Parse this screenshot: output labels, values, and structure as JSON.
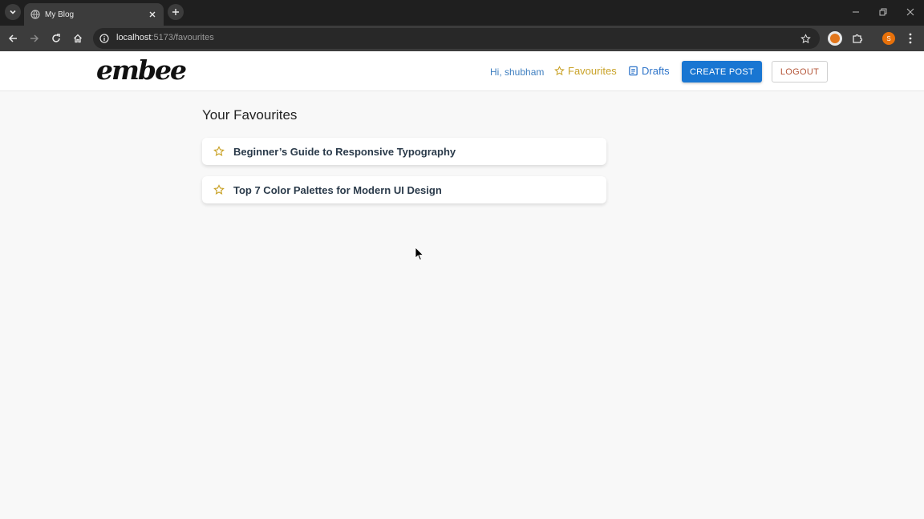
{
  "browser": {
    "tab_title": "My Blog",
    "url_host": "localhost",
    "url_path": ":5173/favourites",
    "profile_initial": "S"
  },
  "header": {
    "logo": "embee",
    "greeting": "Hi, shubham",
    "nav_favourites": "Favourites",
    "nav_drafts": "Drafts",
    "create_post": "CREATE POST",
    "logout": "LOGOUT"
  },
  "main": {
    "title": "Your Favourites",
    "favourites": [
      {
        "title": "Beginner’s Guide to Responsive Typography"
      },
      {
        "title": "Top 7 Color Palettes for Modern UI Design"
      }
    ]
  },
  "colors": {
    "accent": "#1976d2",
    "favourite_star": "#c9a227",
    "drafts_link": "#2e74c9",
    "logout_text": "#b5573a"
  }
}
